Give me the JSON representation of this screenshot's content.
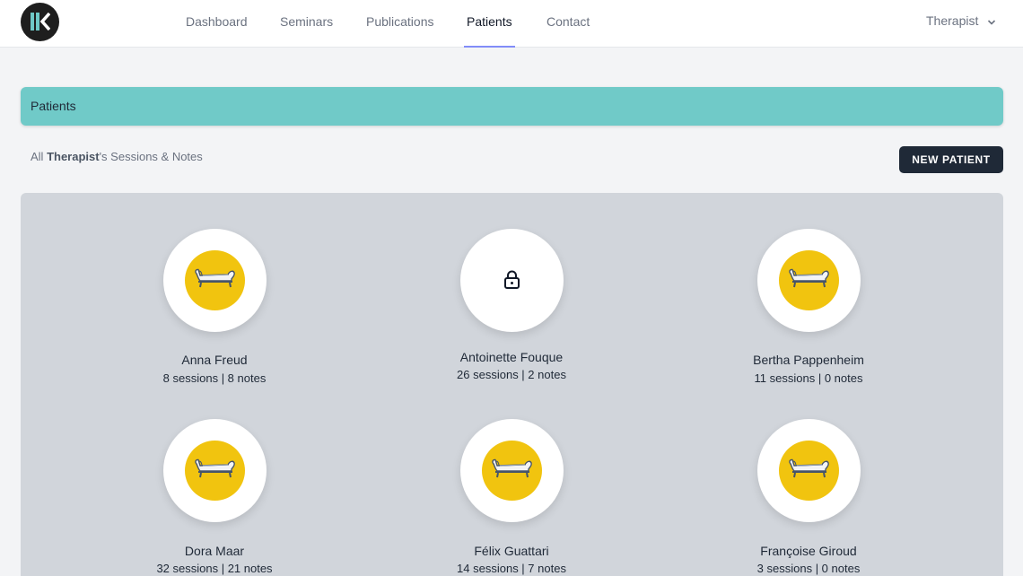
{
  "nav": {
    "items": [
      {
        "label": "Dashboard"
      },
      {
        "label": "Seminars"
      },
      {
        "label": "Publications"
      },
      {
        "label": "Patients",
        "active": true
      },
      {
        "label": "Contact"
      }
    ],
    "user": "Therapist"
  },
  "banner": {
    "title": "Patients"
  },
  "subtitle": {
    "prefix": "All ",
    "user": "Therapist",
    "suffix": "'s Sessions & Notes"
  },
  "actions": {
    "new_patient": "NEW PATIENT"
  },
  "patients": [
    {
      "name": "Anna Freud",
      "stats": "8 sessions | 8 notes",
      "icon": "couch-icon"
    },
    {
      "name": "Antoinette Fouque",
      "stats": "26 sessions | 2 notes",
      "icon": "lock-icon"
    },
    {
      "name": "Bertha Pappenheim",
      "stats": "11 sessions | 0 notes",
      "icon": "couch-icon"
    },
    {
      "name": "Dora Maar",
      "stats": "32 sessions | 21 notes",
      "icon": "couch-icon"
    },
    {
      "name": "Félix Guattari",
      "stats": "14 sessions | 7 notes",
      "icon": "couch-icon"
    },
    {
      "name": "Françoise Giroud",
      "stats": "3 sessions | 0 notes",
      "icon": "couch-icon"
    }
  ],
  "colors": {
    "accent": "#70cac8",
    "avatar_fill": "#f1c40f",
    "button": "#1f2937",
    "nav_underline": "#818cf8"
  }
}
